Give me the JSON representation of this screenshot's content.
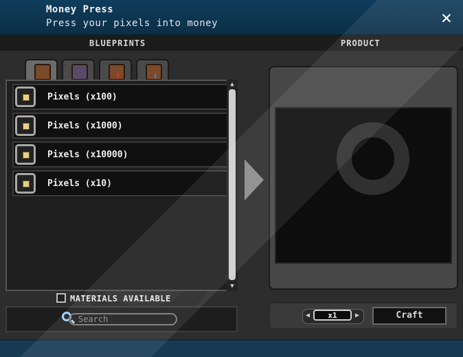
{
  "window": {
    "title": "Money Press",
    "subtitle": "Press your pixels into money",
    "close_icon": "close-icon"
  },
  "headers": {
    "blueprints": "BLUEPRINTS",
    "product": "PRODUCT"
  },
  "tabs": [
    {
      "icon": "blueprint-book-icon",
      "active": true
    },
    {
      "icon": "blueprint-book-wand-icon",
      "active": false
    },
    {
      "icon": "upgrade-up-arrow-icon",
      "active": false
    },
    {
      "icon": "downgrade-down-arrow-icon",
      "active": false
    }
  ],
  "recipes": [
    {
      "label": "Pixels (x100)",
      "icon": "pixel-icon"
    },
    {
      "label": "Pixels (x1000)",
      "icon": "pixel-icon"
    },
    {
      "label": "Pixels (x10000)",
      "icon": "pixel-icon"
    },
    {
      "label": "Pixels (x10)",
      "icon": "pixel-icon"
    }
  ],
  "filters": {
    "materials_available": "MATERIALS AVAILABLE"
  },
  "search": {
    "placeholder": "Search",
    "value": ""
  },
  "craft": {
    "quantity": "x1",
    "button_label": "Craft"
  },
  "colors": {
    "title_bar": "#0f3d5c",
    "panel_bg": "#1e1e1e",
    "accent_pixel": "#e6d08a"
  }
}
